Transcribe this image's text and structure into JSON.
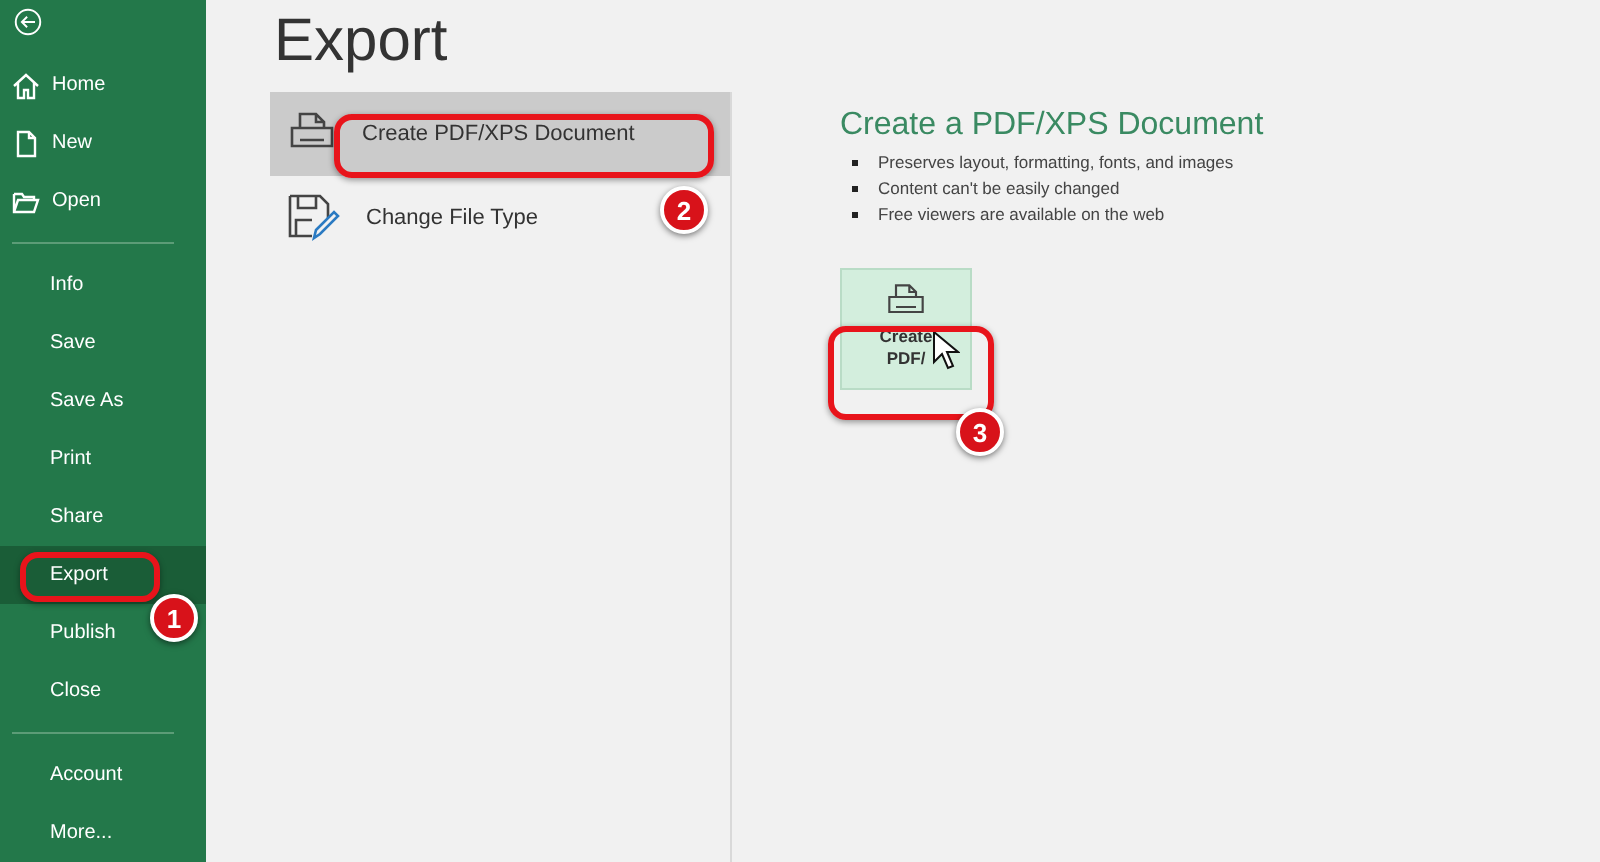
{
  "sidebar": {
    "groups": [
      [
        {
          "label": "Home",
          "selected": false
        },
        {
          "label": "New",
          "selected": false
        },
        {
          "label": "Open",
          "selected": false
        }
      ],
      [
        {
          "label": "Info",
          "selected": false
        },
        {
          "label": "Save",
          "selected": false
        },
        {
          "label": "Save As",
          "selected": false
        },
        {
          "label": "Print",
          "selected": false
        },
        {
          "label": "Share",
          "selected": false
        },
        {
          "label": "Export",
          "selected": true
        },
        {
          "label": "Publish",
          "selected": false
        },
        {
          "label": "Close",
          "selected": false
        }
      ],
      [
        {
          "label": "Account",
          "selected": false
        },
        {
          "label": "More..."
        }
      ]
    ]
  },
  "page": {
    "title": "Export",
    "options": [
      {
        "label": "Create PDF/XPS Document",
        "selected": true
      },
      {
        "label": "Change File Type",
        "selected": false
      }
    ],
    "detail": {
      "heading": "Create a PDF/XPS Document",
      "bullets": [
        "Preserves layout, formatting, fonts, and images",
        "Content can't be easily changed",
        "Free viewers are available on the web"
      ],
      "button": {
        "lines": [
          "Create",
          "PDF/"
        ]
      }
    }
  },
  "callouts": [
    "1",
    "2",
    "3"
  ]
}
